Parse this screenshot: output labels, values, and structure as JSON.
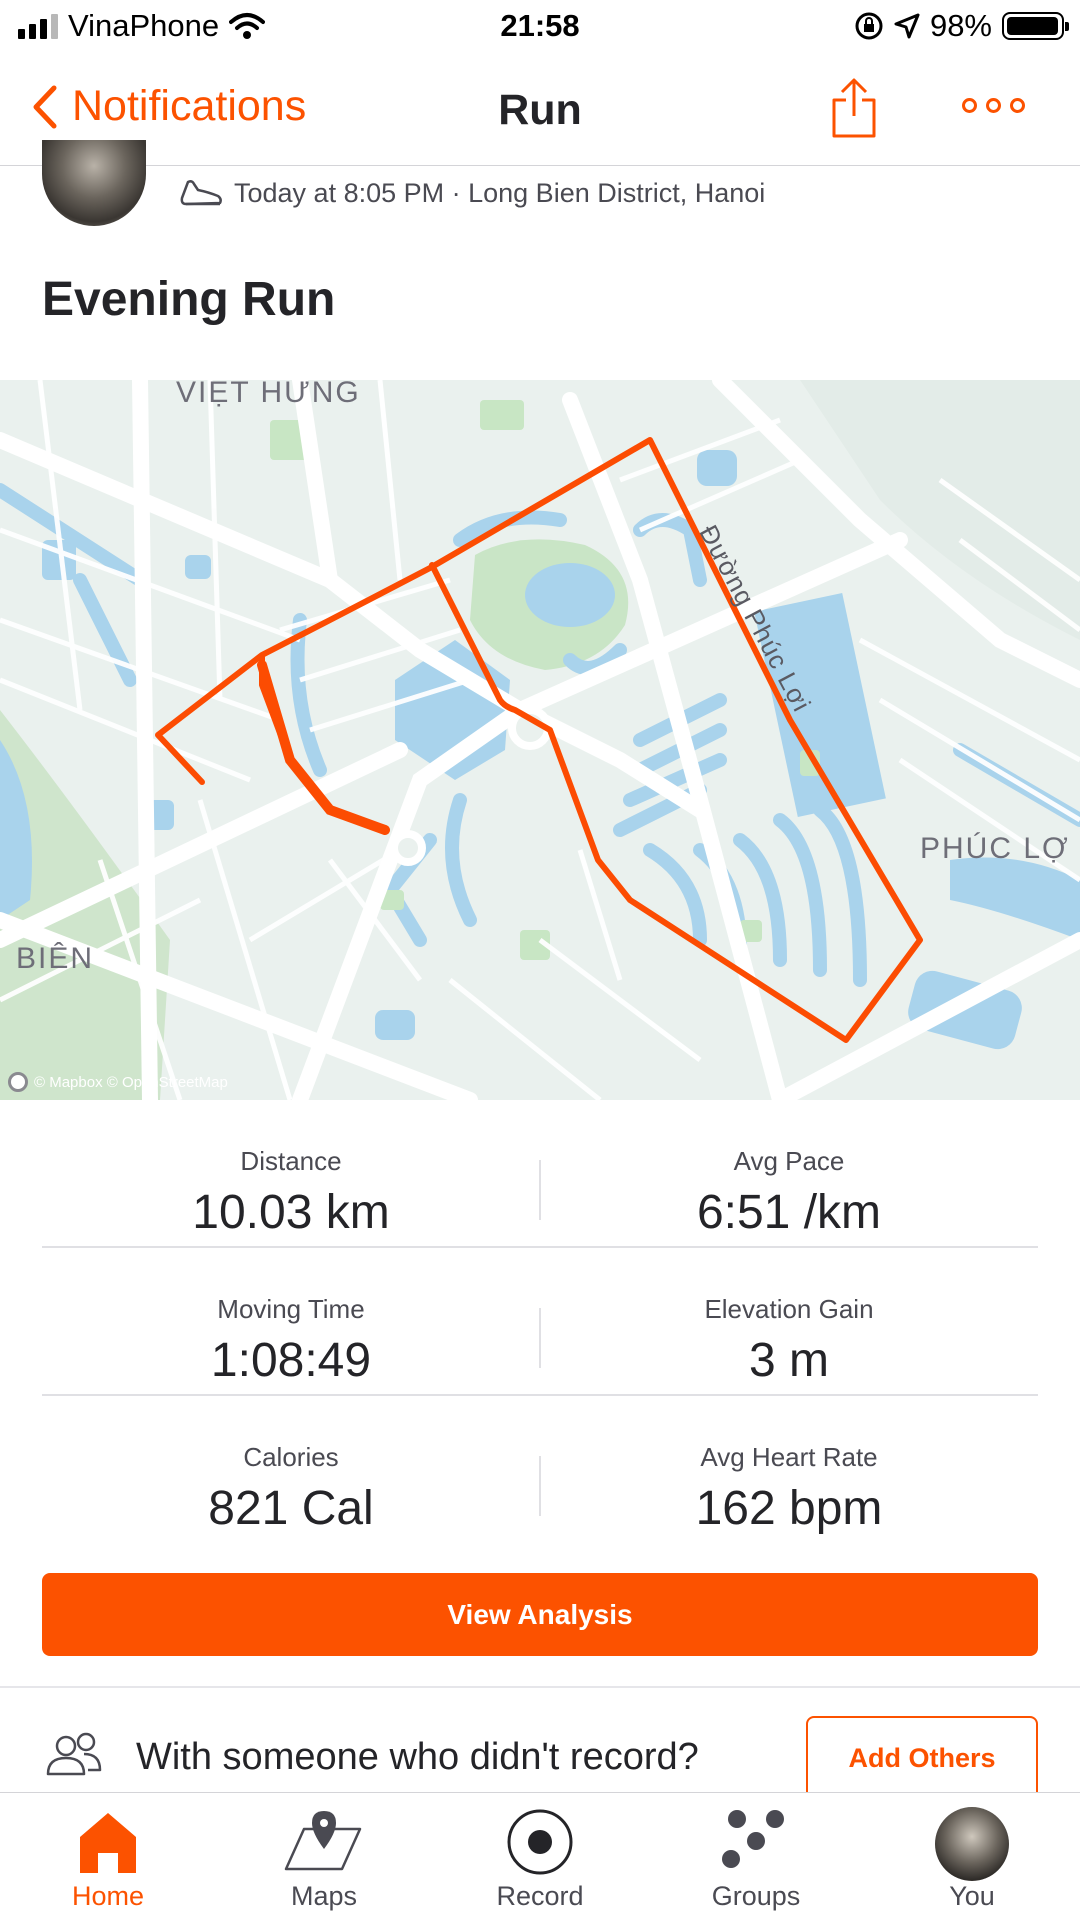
{
  "status_bar": {
    "carrier": "VinaPhone",
    "time": "21:58",
    "battery_percent": "98%",
    "battery_level": 0.98
  },
  "nav": {
    "back_label": "Notifications",
    "title": "Run"
  },
  "activity": {
    "meta": "Today at 8:05 PM · Long Bien District, Hanoi",
    "title": "Evening Run"
  },
  "map": {
    "labels": {
      "viet_hung": "VIỆT HƯNG",
      "phuc_loi_road": "Đường Phúc Lợi",
      "phuc_loi": "PHÚC LỢ",
      "bien": "BIÊN"
    },
    "attribution": "© Mapbox © OpenStreetMap",
    "route_color": "#fc4c02"
  },
  "stats": [
    {
      "left": {
        "label": "Distance",
        "value": "10.03 km"
      },
      "right": {
        "label": "Avg Pace",
        "value": "6:51 /km"
      }
    },
    {
      "left": {
        "label": "Moving Time",
        "value": "1:08:49"
      },
      "right": {
        "label": "Elevation Gain",
        "value": "3 m"
      }
    },
    {
      "left": {
        "label": "Calories",
        "value": "821 Cal"
      },
      "right": {
        "label": "Avg Heart Rate",
        "value": "162 bpm"
      }
    }
  ],
  "buttons": {
    "view_analysis": "View Analysis",
    "add_others": "Add Others"
  },
  "with_someone_text": "With someone who didn't record?",
  "tabs": [
    {
      "label": "Home",
      "icon": "home-icon",
      "active": true
    },
    {
      "label": "Maps",
      "icon": "maps-icon",
      "active": false
    },
    {
      "label": "Record",
      "icon": "record-icon",
      "active": false
    },
    {
      "label": "Groups",
      "icon": "groups-icon",
      "active": false
    },
    {
      "label": "You",
      "icon": "avatar",
      "active": false
    }
  ],
  "colors": {
    "accent": "#fc5200",
    "text": "#242428",
    "water": "#a9d3ec",
    "park": "#c8e6c4"
  }
}
